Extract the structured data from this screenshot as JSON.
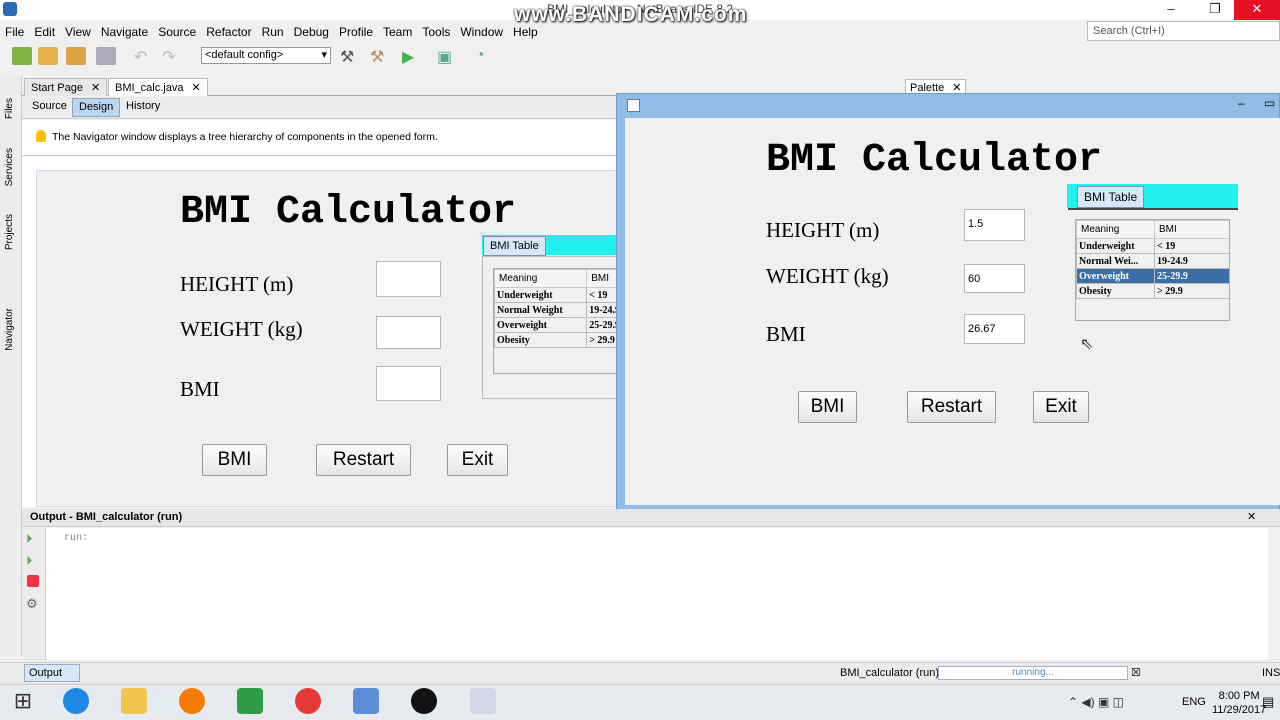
{
  "window": {
    "title": "BMI_calculator - NetBeans IDE 8.2",
    "watermark": "www.BANDICAM.com",
    "minimize": "–",
    "maximize": "❐",
    "close": "✕"
  },
  "menu": [
    "File",
    "Edit",
    "View",
    "Navigate",
    "Source",
    "Refactor",
    "Run",
    "Debug",
    "Profile",
    "Team",
    "Tools",
    "Window",
    "Help"
  ],
  "search": {
    "placeholder": "Search (Ctrl+I)"
  },
  "toolbar": {
    "config": "<default config>"
  },
  "side_tabs": [
    "Files",
    "Services",
    "Projects",
    "Navigator"
  ],
  "editor_tabs": [
    {
      "label": "Start Page"
    },
    {
      "label": "BMI_calc.java"
    }
  ],
  "palette_tab": "Palette",
  "sub_tabs": [
    "Source",
    "Design",
    "History"
  ],
  "navigator_hint": "The Navigator window displays a tree hierarchy of components in the opened form.",
  "form": {
    "title": "BMI Calculator",
    "height_label": "HEIGHT (m)",
    "weight_label": "WEIGHT (kg)",
    "bmi_label": "BMI",
    "buttons": [
      "BMI",
      "Restart",
      "Exit"
    ],
    "table_tab": "BMI Table",
    "table_headers": [
      "Meaning",
      "BMI"
    ],
    "table_rows": [
      [
        "Underweight",
        "< 19"
      ],
      [
        "Normal Weight",
        "19-24.9"
      ],
      [
        "Overweight",
        "25-29.9"
      ],
      [
        "Obesity",
        "> 29.9"
      ]
    ]
  },
  "running_app": {
    "title": "BMI Calculator",
    "height_label": "HEIGHT (m)",
    "weight_label": "WEIGHT (kg)",
    "bmi_label": "BMI",
    "height_value": "1.5",
    "weight_value": "60",
    "bmi_value": "26.67",
    "buttons": [
      "BMI",
      "Restart",
      "Exit"
    ],
    "table_tab": "BMI Table",
    "table_headers": [
      "Meaning",
      "BMI"
    ],
    "table_rows": [
      [
        "Underweight",
        "< 19"
      ],
      [
        "Normal Wei...",
        "19-24.9"
      ],
      [
        "Overweight",
        "25-29.9"
      ],
      [
        "Obesity",
        "> 29.9"
      ]
    ],
    "selected_row": 2
  },
  "output": {
    "title": "Output - BMI_calculator (run)",
    "text": "run:",
    "tab": "Output"
  },
  "status": {
    "task": "BMI_calculator (run)",
    "progress": "running...",
    "mode": "INS"
  },
  "taskbar": {
    "lang": "ENG",
    "time": "8:00 PM",
    "date": "11/29/2017"
  },
  "colors": {
    "accent": "#24f0f0",
    "selection": "#3a6ea5",
    "frame": "#8fbde6"
  }
}
